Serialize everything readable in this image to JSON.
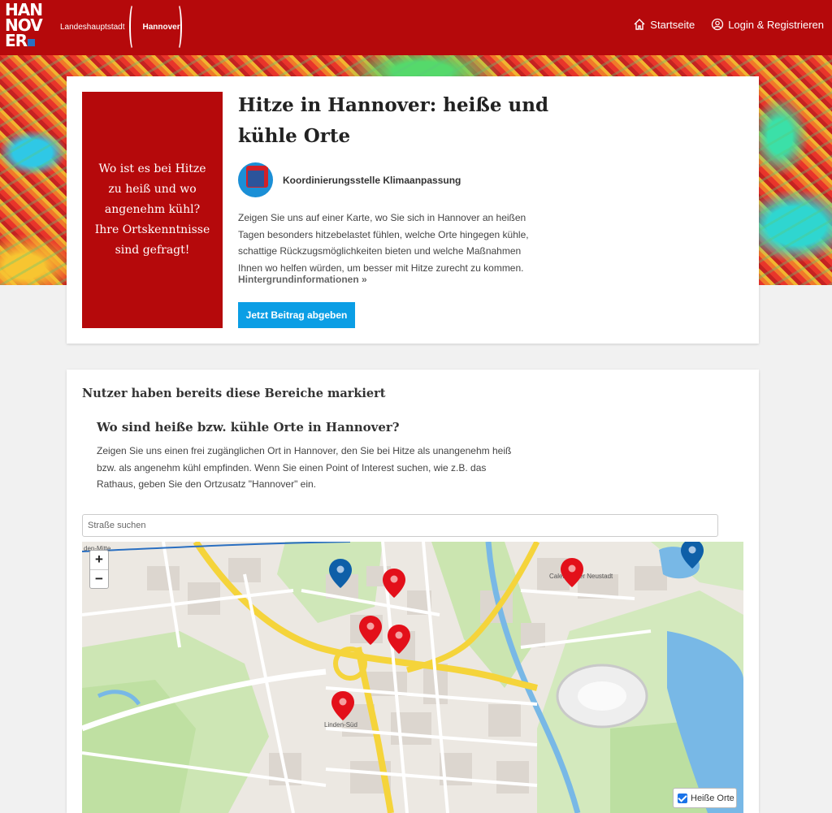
{
  "header": {
    "logo_lines": [
      "HAN",
      "NOV",
      "ER"
    ],
    "brand_left": "Landeshauptstadt",
    "brand_right": "Hannover",
    "nav": [
      {
        "label": "Startseite",
        "icon": "home-icon"
      },
      {
        "label": "Login & Registrieren",
        "icon": "user-icon"
      }
    ],
    "color": "#b5090b"
  },
  "hero": {
    "prompt": "Wo ist es bei Hitze zu heiß und wo angenehm kühl? Ihre Ortskenntnisse sind gefragt!",
    "title": "Hitze in Hannover: heiße und kühle Orte",
    "org": "Koordinierungsstelle Klimaanpassung",
    "description": "Zeigen Sie uns auf einer Karte, wo Sie sich in Hannover an heißen Tagen besonders hitzebelastet fühlen, welche Orte hingegen kühle, schattige Rückzugsmöglichkeiten bieten und welche Maßnahmen Ihnen wo helfen würden, um besser mit Hitze zurecht zu kommen.",
    "background_link": "Hintergrundinformationen »",
    "cta": "Jetzt Beitrag abgeben",
    "cta_color": "#0b9ee5"
  },
  "map_section": {
    "title": "Nutzer haben bereits diese Bereiche markiert",
    "question": "Wo sind heiße bzw. kühle Orte in Hannover?",
    "question_desc": "Zeigen Sie uns einen frei zugänglichen Ort in Hannover, den Sie bei Hitze als unangenehm heiß bzw. als angenehm kühl empfinden. Wenn Sie einen Point of Interest suchen, wie z.B. das Rathaus, geben Sie den Ortzusatz \"Hannover\" ein.",
    "search_placeholder": "Straße suchen",
    "zoom_in": "+",
    "zoom_out": "−",
    "legend_label": "Heiße Orte",
    "labels": {
      "linden_mitte": "den-Mitte",
      "calenberg": "Calenberger Neustadt",
      "linden_sued": "Linden-Süd"
    },
    "marker_colors": {
      "hot": "#e3101a",
      "cool": "#0e5fa8"
    },
    "markers_hot_count": 6,
    "markers_cool_count": 2
  }
}
